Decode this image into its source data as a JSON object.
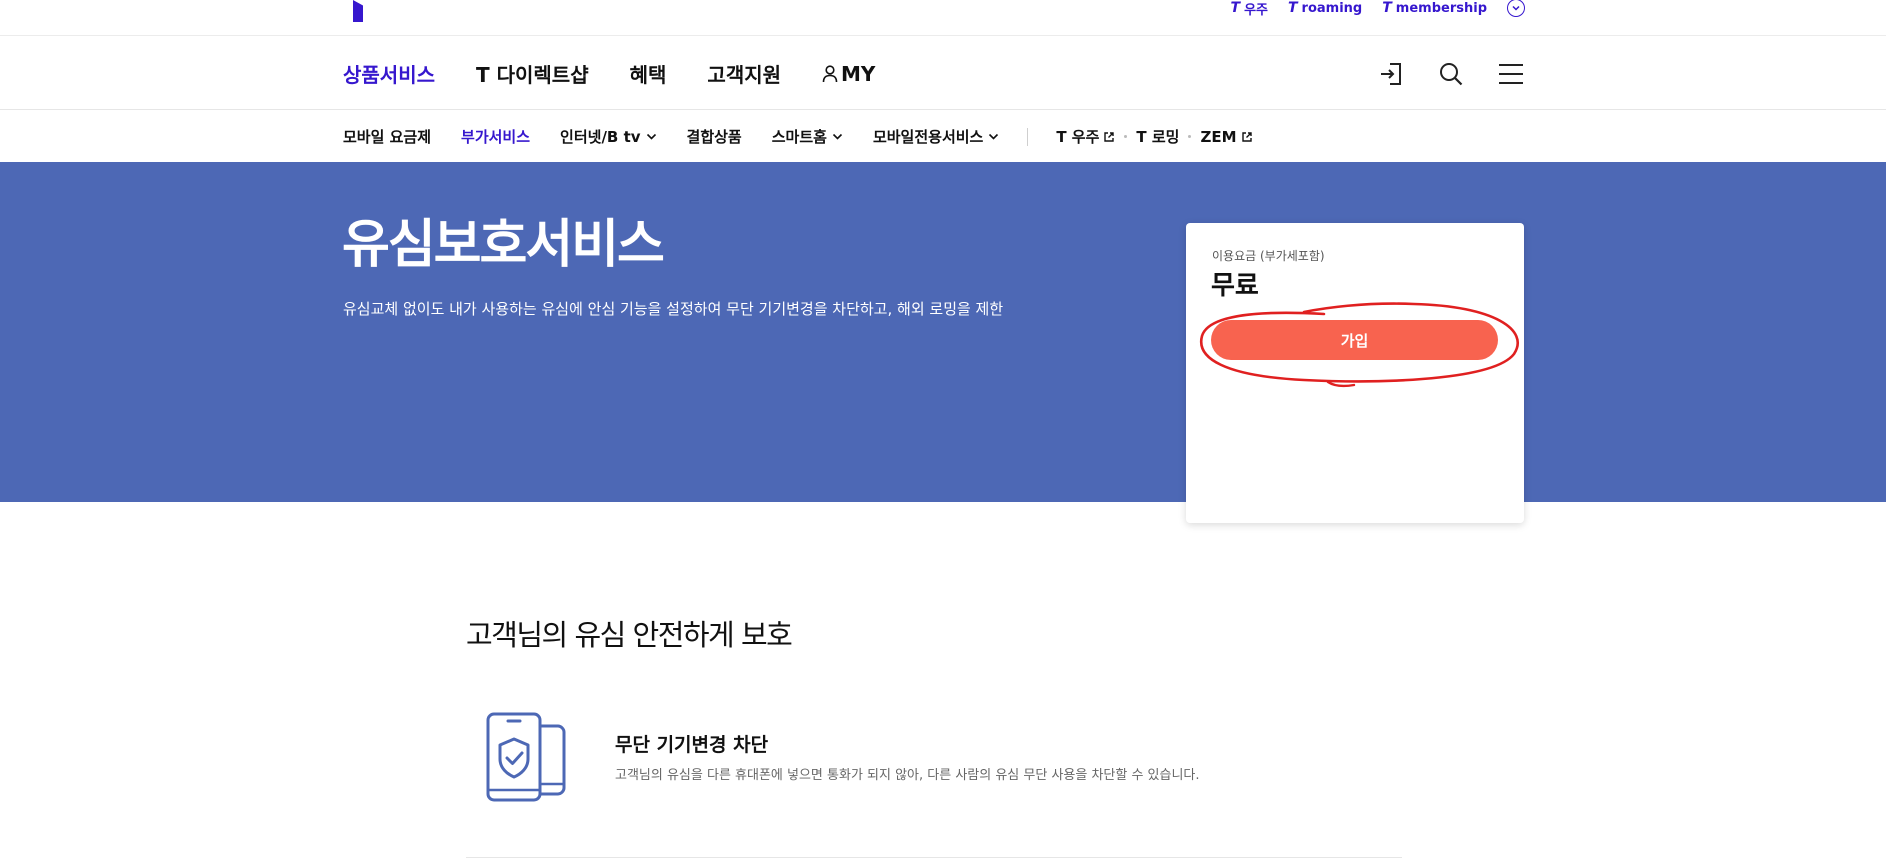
{
  "util_bar": {
    "links": [
      {
        "prefix": "T",
        "label": "우주"
      },
      {
        "prefix": "T",
        "label": "roaming"
      },
      {
        "prefix": "T",
        "label": "membership"
      }
    ]
  },
  "gnb": {
    "items": [
      "상품서비스",
      "T 다이렉트샵",
      "혜택",
      "고객지원"
    ],
    "my_label": "MY",
    "active_index": 0,
    "icons": [
      "login-icon",
      "search-icon",
      "menu-icon"
    ]
  },
  "subnav": {
    "items": [
      {
        "label": "모바일 요금제",
        "dropdown": false
      },
      {
        "label": "부가서비스",
        "dropdown": false,
        "active": true
      },
      {
        "label": "인터넷/B tv",
        "dropdown": true
      },
      {
        "label": "결합상품",
        "dropdown": false
      },
      {
        "label": "스마트홈",
        "dropdown": true
      },
      {
        "label": "모바일전용서비스",
        "dropdown": true
      }
    ],
    "external": [
      "T 우주",
      "T 로밍",
      "ZEM"
    ]
  },
  "hero": {
    "title": "유심보호서비스",
    "description": "유심교체 없이도 내가 사용하는 유심에 안심 기능을 설정하여 무단 기기변경을 차단하고, 해외 로밍을 제한",
    "background_color": "#4d68b5"
  },
  "price_card": {
    "label": "이용요금 (부가세포함)",
    "value": "무료",
    "join_button": "가입",
    "button_color": "#f8634f"
  },
  "content": {
    "section_title": "고객님의 유심 안전하게 보호",
    "features": [
      {
        "icon": "phone-shield-icon",
        "title": "무단 기기변경 차단",
        "description": "고객님의 유심을 다른 휴대폰에 넣으면 통화가 되지 않아, 다른 사람의 유심 무단 사용을 차단할 수 있습니다."
      }
    ]
  },
  "colors": {
    "brand": "#3617ce",
    "annotation": "#e02020"
  }
}
